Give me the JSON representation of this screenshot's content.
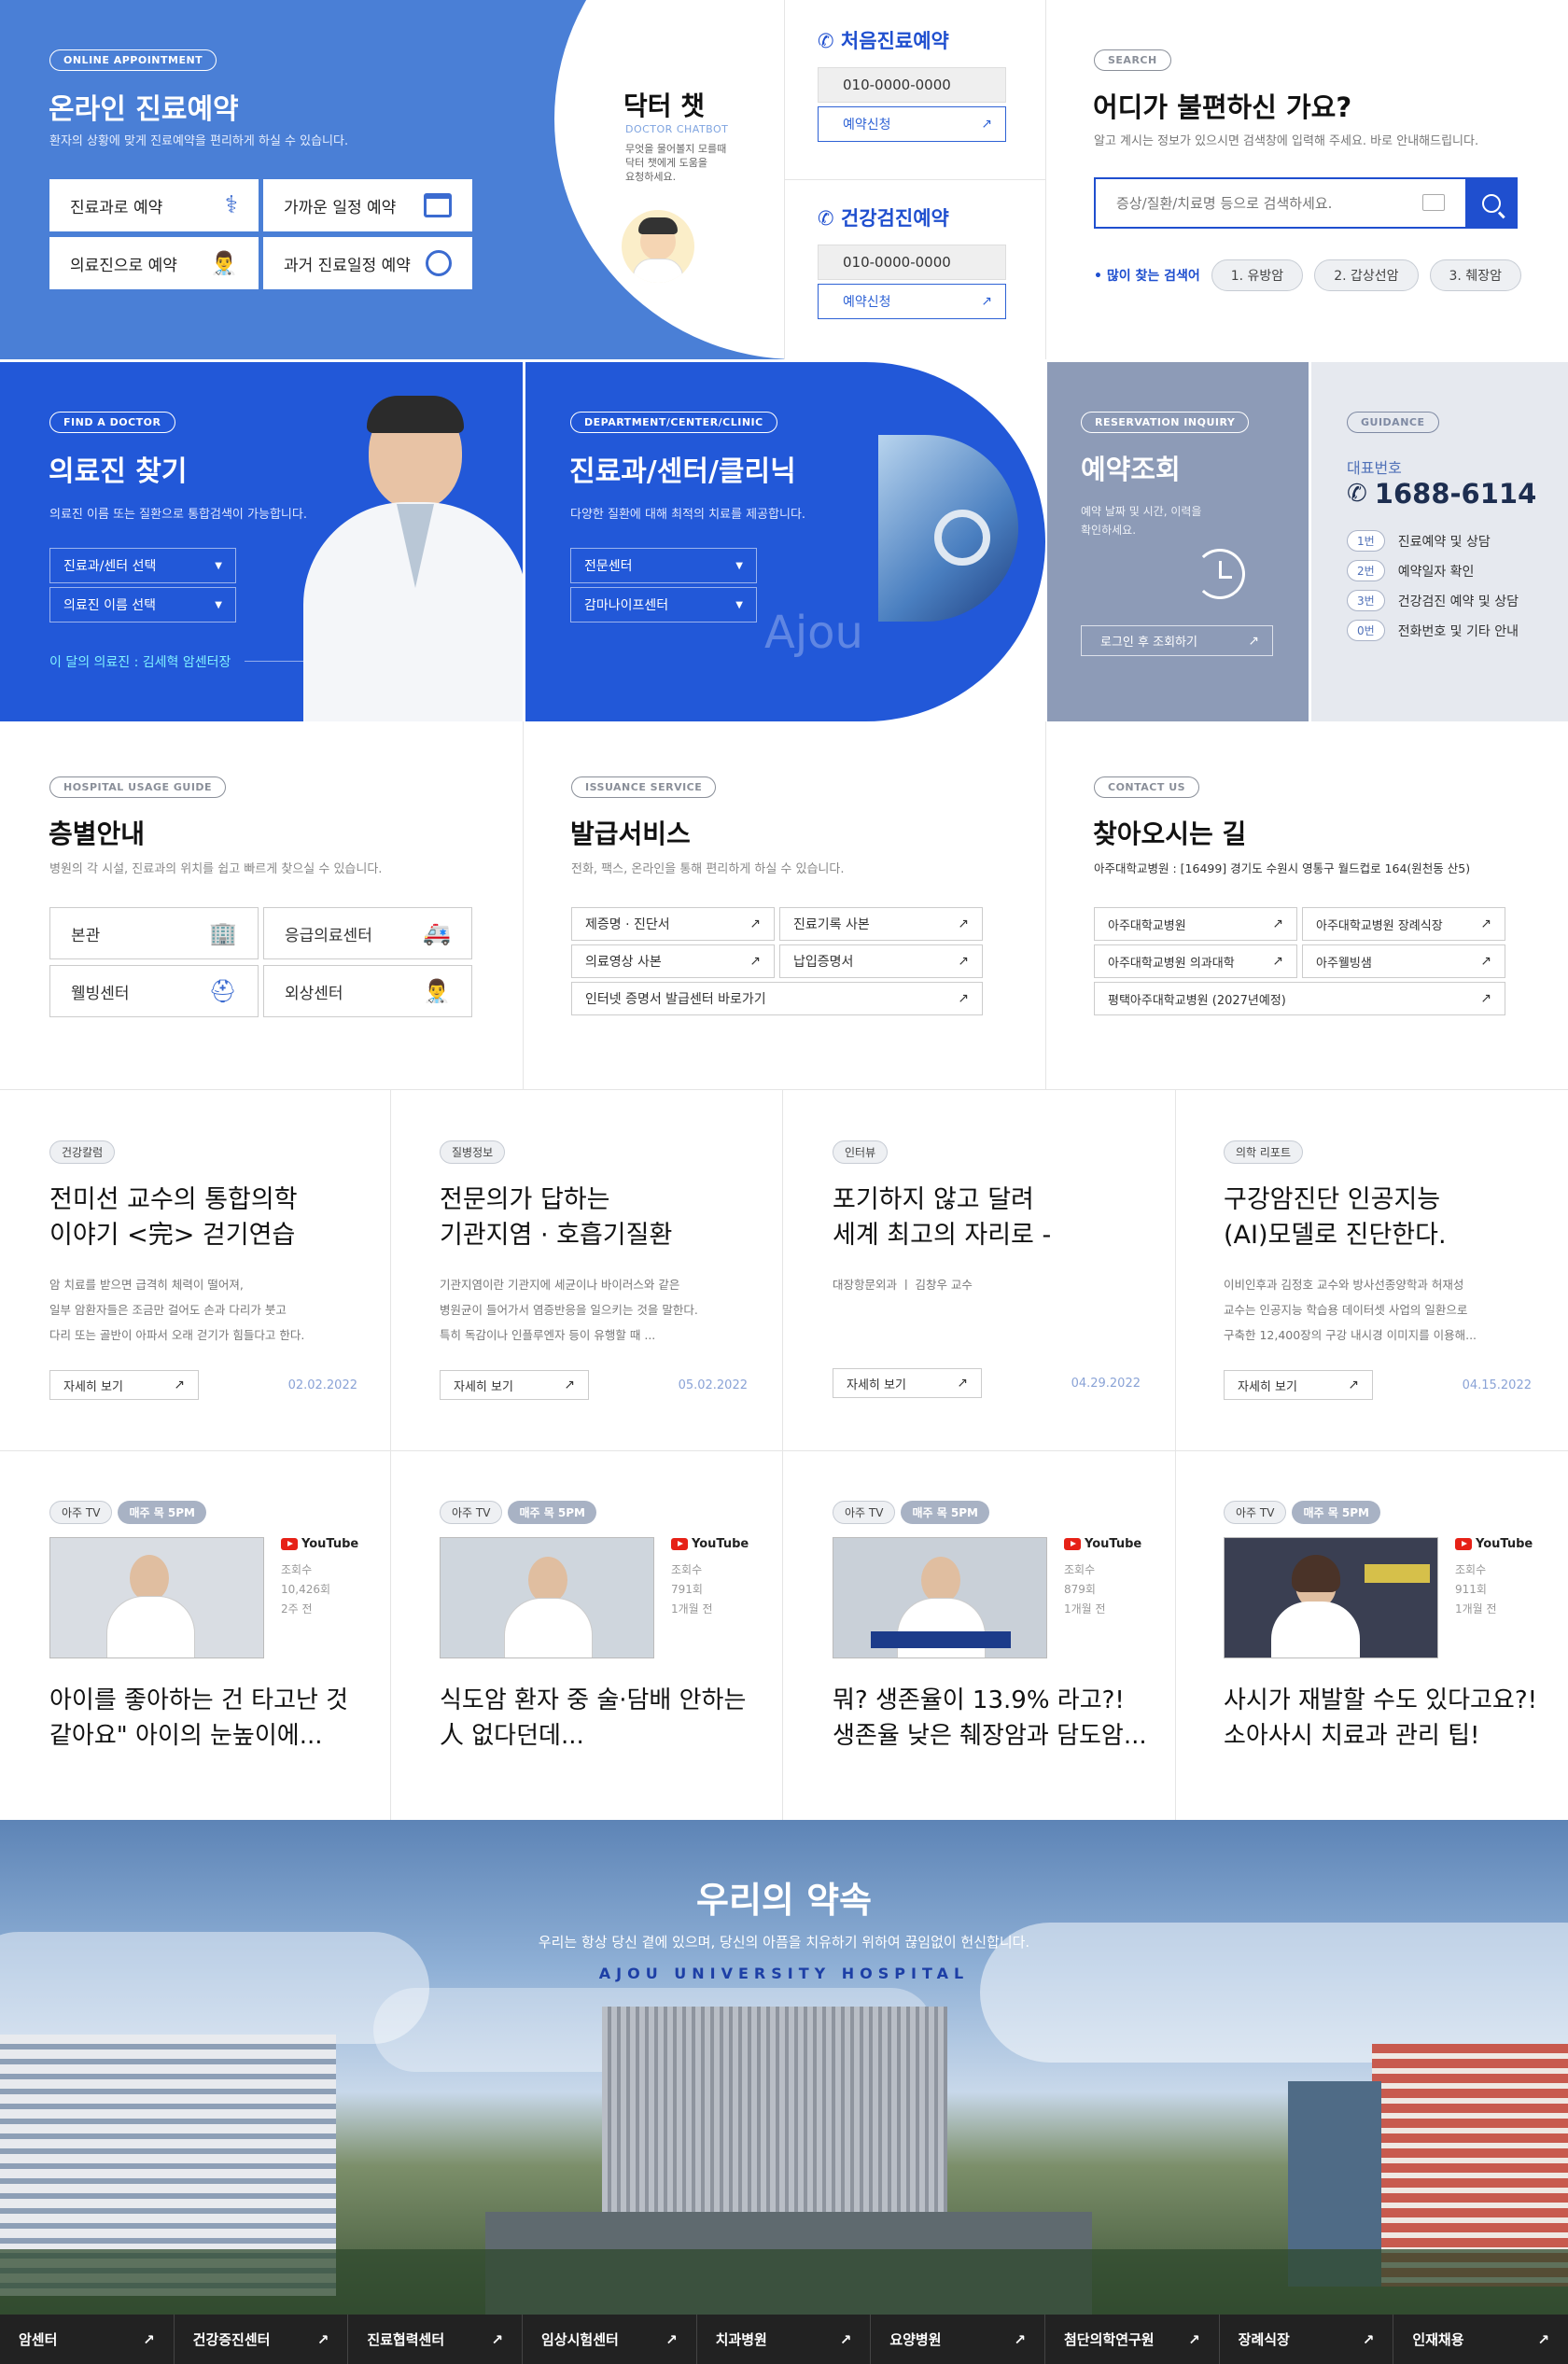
{
  "online": {
    "tag": "ONLINE APPOINTMENT",
    "title": "온라인 진료예약",
    "desc": "환자의 상황에 맞게 진료예약을 편리하게 하실 수 있습니다.",
    "buttons": [
      "진료과로 예약",
      "가까운 일정 예약",
      "의료진으로 예약",
      "과거 진료일정 예약"
    ]
  },
  "chatbot": {
    "title": "닥터 챗",
    "subtitle": "DOCTOR CHATBOT",
    "desc": "무엇을 물어볼지 모를때\n닥터 챗에게 도움을\n요청하세요."
  },
  "first_visit": {
    "title": "처음진료예약",
    "phone": "010-0000-0000",
    "button": "예약신청"
  },
  "checkup": {
    "title": "건강검진예약",
    "phone": "010-0000-0000",
    "button": "예약신청"
  },
  "search": {
    "tag": "SEARCH",
    "title": "어디가 불편하신 가요?",
    "desc": "알고 계시는 정보가 있으시면 검색창에 입력해 주세요. 바로 안내해드립니다.",
    "placeholder": "증상/질환/치료명 등으로 검색하세요.",
    "popular_label": "• 많이 찾는 검색어",
    "keywords": [
      "1. 유방암",
      "2. 갑상선암",
      "3. 췌장암"
    ]
  },
  "doctor": {
    "tag": "FIND A DOCTOR",
    "title": "의료진 찾기",
    "desc": "의료진 이름 또는 질환으로 통합검색이 가능합니다.",
    "select1": "진료과/센터 선택",
    "select2": "의료진 이름 선택",
    "month": "이 달의 의료진 : 김세혁 암센터장"
  },
  "dept": {
    "tag": "DEPARTMENT/CENTER/CLINIC",
    "title": "진료과/센터/클리닉",
    "desc": "다양한 질환에 대해 최적의 치료를 제공합니다.",
    "select1": "전문센터",
    "select2": "감마나이프센터",
    "watermark": "Ajou"
  },
  "reservation": {
    "tag": "RESERVATION INQUIRY",
    "title": "예약조회",
    "desc": "예약 날짜 및 시간, 이력을\n확인하세요.",
    "button": "로그인 후 조회하기"
  },
  "guidance": {
    "tag": "GUIDANCE",
    "label": "대표번호",
    "phone": "1688-6114",
    "items": [
      {
        "num": "1번",
        "text": "진료예약 및 상담"
      },
      {
        "num": "2번",
        "text": "예약일자 확인"
      },
      {
        "num": "3번",
        "text": "건강검진 예약 및 상담"
      },
      {
        "num": "0번",
        "text": "전화번호 및 기타 안내"
      }
    ]
  },
  "usage": {
    "tag": "HOSPITAL USAGE GUIDE",
    "title": "층별안내",
    "desc": "병원의 각 시설, 진료과의 위치를 쉽고 빠르게 찾으실 수 있습니다.",
    "buttons": [
      "본관",
      "응급의료센터",
      "웰빙센터",
      "외상센터"
    ]
  },
  "issuance": {
    "tag": "ISSUANCE SERVICE",
    "title": "발급서비스",
    "desc": "전화, 팩스, 온라인을 통해 편리하게 하실 수 있습니다.",
    "buttons": [
      "제증명 · 진단서",
      "진료기록 사본",
      "의료영상 사본",
      "납입증명서"
    ],
    "wide": "인터넷 증명서 발급센터 바로가기"
  },
  "contact": {
    "tag": "CONTACT US",
    "title": "찾아오시는 길",
    "address": "아주대학교병원 : [16499] 경기도 수원시 영통구 월드컵로 164(원천동 산5)",
    "buttons": [
      "아주대학교병원",
      "아주대학교병원 장례식장",
      "아주대학교병원 의과대학",
      "아주웰빙샘"
    ],
    "wide": "평택아주대학교병원 (2027년예정)"
  },
  "articles": [
    {
      "tag": "건강칼럼",
      "title": "전미선 교수의 통합의학\n이야기 <完> 걷기연습",
      "body": "암 치료를 받으면 급격히 체력이 떨어져,\n일부 암환자들은 조금만 걸어도 손과 다리가 붓고\n다리 또는 골반이 아파서 오래 걷기가 힘들다고 한다.",
      "button": "자세히 보기",
      "date": "02.02.2022"
    },
    {
      "tag": "질병정보",
      "title": "전문의가 답하는\n기관지염 · 호흡기질환",
      "body": "기관지염이란 기관지에 세균이나 바이러스와 같은\n병원균이 들어가서 염증반응을 일으키는 것을 말한다.\n특히 독감이나 인플루엔자 등이 유행할 때 ...",
      "button": "자세히 보기",
      "date": "05.02.2022"
    },
    {
      "tag": "인터뷰",
      "title": "포기하지 않고 달려\n세계 최고의 자리로 -",
      "body": "대장항문외과 ㅣ 김창우 교수",
      "button": "자세히 보기",
      "date": "04.29.2022"
    },
    {
      "tag": "의학 리포트",
      "title": "구강암진단 인공지능\n(AI)모델로 진단한다.",
      "body": "이비인후과 김정호 교수와 방사선종양학과 허재성\n교수는 인공지능 학습용 데이터셋 사업의 일환으로\n구축한 12,400장의 구강 내시경 이미지를 이용해...",
      "button": "자세히 보기",
      "date": "04.15.2022"
    }
  ],
  "videos": [
    {
      "tag1": "아주 TV",
      "tag2": "매주 목 5PM",
      "yt": "YouTube",
      "views_label": "조회수",
      "views": "10,426회",
      "ago": "2주 전",
      "title": "아이를 좋아하는 건 타고난 것\n같아요\" 아이의 눈높이에...",
      "thumb_color": "#d9dde3"
    },
    {
      "tag1": "아주 TV",
      "tag2": "매주 목 5PM",
      "yt": "YouTube",
      "views_label": "조회수",
      "views": "791회",
      "ago": "1개월 전",
      "title": "식도암 환자 중 술·담배 안하는\n人 없다던데...",
      "thumb_color": "#cfd6dd"
    },
    {
      "tag1": "아주 TV",
      "tag2": "매주 목 5PM",
      "yt": "YouTube",
      "views_label": "조회수",
      "views": "879회",
      "ago": "1개월 전",
      "title": "뭐? 생존율이 13.9% 라고?!\n생존율 낮은 췌장암과 담도암...",
      "thumb_color": "#c9d0d8"
    },
    {
      "tag1": "아주 TV",
      "tag2": "매주 목 5PM",
      "yt": "YouTube",
      "views_label": "조회수",
      "views": "911회",
      "ago": "1개월 전",
      "title": "사시가 재발할 수도 있다고요?!\n소아사시 치료과 관리 팁!",
      "thumb_color": "#3a3f52"
    }
  ],
  "promise": {
    "title": "우리의 약속",
    "desc": "우리는 항상 당신 곁에 있으며, 당신의 아픔을 치유하기 위하여 끊임없이 헌신합니다.",
    "sub": "AJOU UNIVERSITY HOSPITAL"
  },
  "footer": [
    "암센터",
    "건강증진센터",
    "진료협력센터",
    "임상시험센터",
    "치과병원",
    "요양병원",
    "첨단의학연구원",
    "장례식장",
    "인재채용"
  ],
  "colors": {
    "blue": "#4a7fd6",
    "deep_blue": "#1f4fcf",
    "gray_blue": "#8d9bb7",
    "light_gray": "#e6e9ef"
  }
}
